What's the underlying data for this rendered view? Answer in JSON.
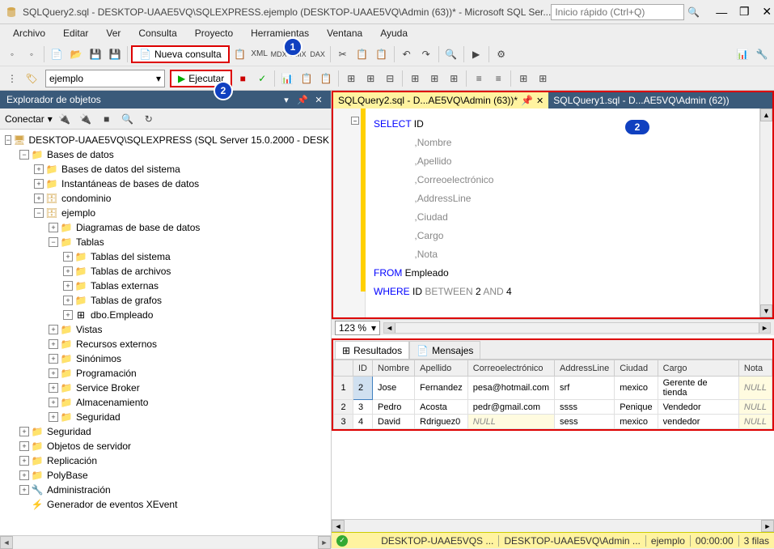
{
  "title": "SQLQuery2.sql - DESKTOP-UAAE5VQ\\SQLEXPRESS.ejemplo (DESKTOP-UAAE5VQ\\Admin (63))* - Microsoft SQL Ser...",
  "quick_search_placeholder": "Inicio rápido (Ctrl+Q)",
  "menu": [
    "Archivo",
    "Editar",
    "Ver",
    "Consulta",
    "Proyecto",
    "Herramientas",
    "Ventana",
    "Ayuda"
  ],
  "toolbar1": {
    "nueva_consulta": "Nueva consulta"
  },
  "toolbar2": {
    "db_selected": "ejemplo",
    "ejecutar": "Ejecutar"
  },
  "badges": {
    "b1": "1",
    "b2": "2",
    "b2_editor": "2"
  },
  "obj_explorer": {
    "title": "Explorador de objetos",
    "conectar": "Conectar",
    "root": "DESKTOP-UAAE5VQ\\SQLEXPRESS (SQL Server 15.0.2000 - DESK",
    "bases_de_datos": "Bases de datos",
    "bd_sistema": "Bases de datos del sistema",
    "instantaneas": "Instantáneas de bases de datos",
    "condominio": "condominio",
    "ejemplo": "ejemplo",
    "diagramas": "Diagramas de base de datos",
    "tablas": "Tablas",
    "tablas_sistema": "Tablas del sistema",
    "tablas_archivos": "Tablas de archivos",
    "tablas_externas": "Tablas externas",
    "tablas_grafos": "Tablas de grafos",
    "dbo_empleado": "dbo.Empleado",
    "vistas": "Vistas",
    "recursos_externos": "Recursos externos",
    "sinonimos": "Sinónimos",
    "programacion": "Programación",
    "service_broker": "Service Broker",
    "almacenamiento": "Almacenamiento",
    "seguridad": "Seguridad",
    "seguridad2": "Seguridad",
    "objetos_servidor": "Objetos de servidor",
    "replicacion": "Replicación",
    "polybase": "PolyBase",
    "administracion": "Administración",
    "generador_eventos": "Generador de eventos XEvent"
  },
  "tabs": {
    "active": "SQLQuery2.sql - D...AE5VQ\\Admin (63))*",
    "inactive": "SQLQuery1.sql - D...AE5VQ\\Admin (62))"
  },
  "sql": {
    "select": "SELECT",
    "id": " ID",
    "nombre": ",Nombre",
    "apellido": ",Apellido",
    "correo": ",Correoelectrónico",
    "address": ",AddressLine",
    "ciudad": ",Ciudad",
    "cargo": ",Cargo",
    "nota": ",Nota",
    "from": "FROM",
    "empleado": " Empleado",
    "where": "WHERE",
    "id2": " ID ",
    "between": "BETWEEN",
    "two": " 2 ",
    "and": "AND",
    "four": " 4"
  },
  "zoom": "123 %",
  "results": {
    "tab_resultados": "Resultados",
    "tab_mensajes": "Mensajes",
    "headers": [
      "",
      "ID",
      "Nombre",
      "Apellido",
      "Correoelectrónico",
      "AddressLine",
      "Ciudad",
      "Cargo",
      "Nota"
    ],
    "rows": [
      {
        "n": "1",
        "id": "2",
        "nombre": "Jose",
        "apellido": "Fernandez",
        "correo": "pesa@hotmail.com",
        "addr": "srf",
        "ciudad": "mexico",
        "cargo": "Gerente de tienda",
        "nota": "NULL"
      },
      {
        "n": "2",
        "id": "3",
        "nombre": "Pedro",
        "apellido": "Acosta",
        "correo": "pedr@gmail.com",
        "addr": "ssss",
        "ciudad": "Penique",
        "cargo": "Vendedor",
        "nota": "NULL"
      },
      {
        "n": "3",
        "id": "4",
        "nombre": "David",
        "apellido": "Rdriguez0",
        "correo": "NULL",
        "addr": "sess",
        "ciudad": "mexico",
        "cargo": "vendedor",
        "nota": "NULL"
      }
    ]
  },
  "status": {
    "server": "DESKTOP-UAAE5VQS ...",
    "user": "DESKTOP-UAAE5VQ\\Admin ...",
    "db": "ejemplo",
    "time": "00:00:00",
    "rows": "3 filas"
  }
}
